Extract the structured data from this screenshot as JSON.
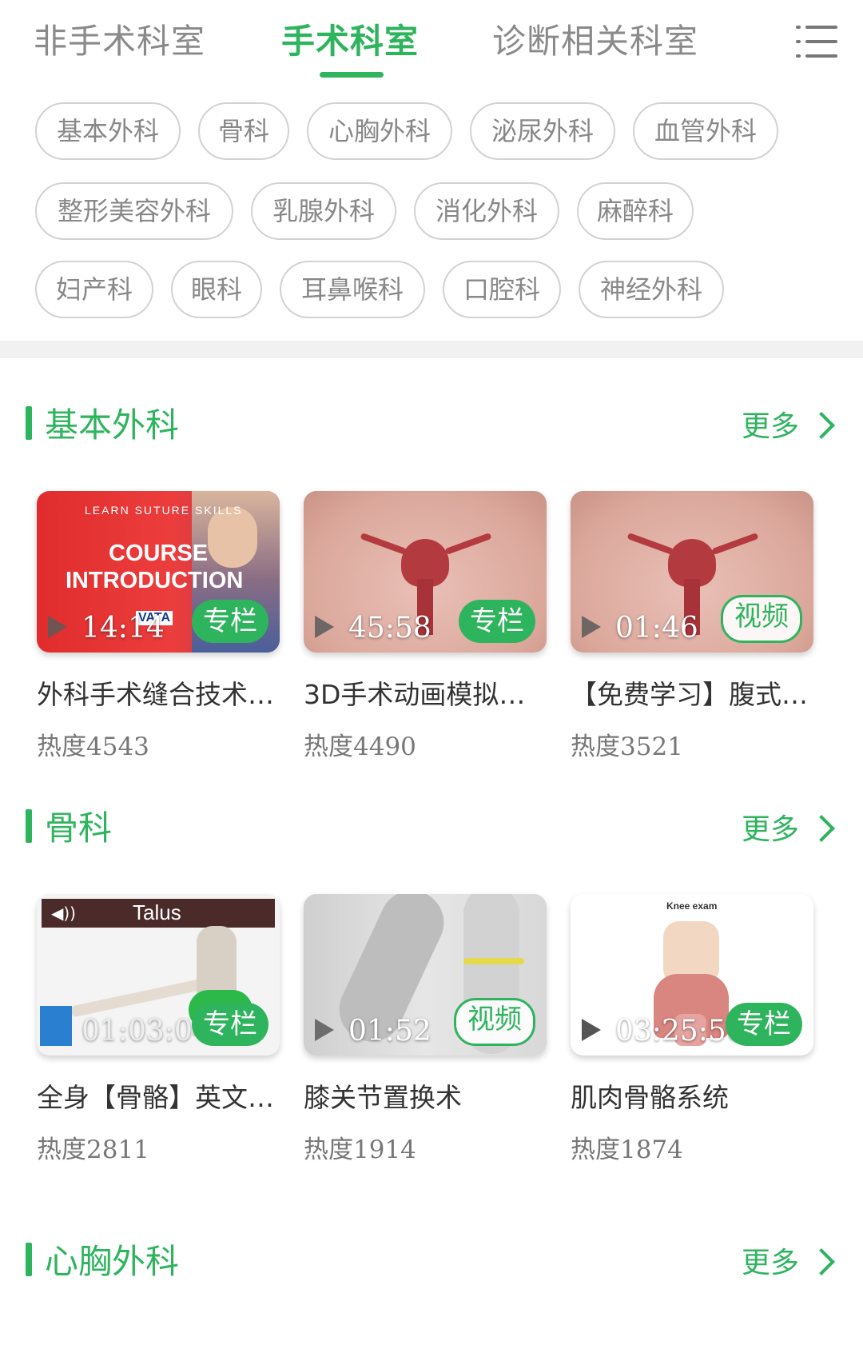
{
  "tabs": [
    {
      "label": "非手术科室",
      "active": false
    },
    {
      "label": "手术科室",
      "active": true
    },
    {
      "label": "诊断相关科室",
      "active": false
    }
  ],
  "menu_icon": "list-menu-icon",
  "chips": [
    [
      "基本外科",
      "骨科",
      "心胸外科",
      "泌尿外科",
      "血管外科"
    ],
    [
      "整形美容外科",
      "乳腺外科",
      "消化外科",
      "麻醉科"
    ],
    [
      "妇产科",
      "眼科",
      "耳鼻喉科",
      "口腔科",
      "神经外科"
    ]
  ],
  "colors": {
    "accent": "#2fb45e",
    "chip_border": "#d2d2d2",
    "muted": "#8a8a8a"
  },
  "sections": [
    {
      "title": "基本外科",
      "more": "更多",
      "cards": [
        {
          "title": "外科手术缝合技术…",
          "duration": "14:14",
          "badge": "专栏",
          "badge_style": "filled",
          "heat_label": "热度",
          "heat": "4543",
          "thumb_text": {
            "top": "LEARN SUTURE SKILLS",
            "line1": "COURSE",
            "line2": "INTRODUCTION",
            "logo": "VATA"
          }
        },
        {
          "title": "3D手术动画模拟…",
          "duration": "45:58",
          "badge": "专栏",
          "badge_style": "filled",
          "heat_label": "热度",
          "heat": "4490"
        },
        {
          "title": "【免费学习】腹式…",
          "duration": "01:46",
          "badge": "视频",
          "badge_style": "outline",
          "heat_label": "热度",
          "heat": "3521"
        }
      ]
    },
    {
      "title": "骨科",
      "more": "更多",
      "cards": [
        {
          "title": "全身【骨骼】英文…",
          "duration": "01:03:04",
          "badge": "专栏",
          "badge_style": "filled",
          "heat_label": "热度",
          "heat": "2811",
          "thumb_text": {
            "banner": "Talus"
          }
        },
        {
          "title": "膝关节置换术",
          "duration": "01:52",
          "badge": "视频",
          "badge_style": "outline",
          "heat_label": "热度",
          "heat": "1914"
        },
        {
          "title": "肌肉骨骼系统",
          "duration": "03:25:50",
          "badge": "专栏",
          "badge_style": "filled",
          "heat_label": "热度",
          "heat": "1874",
          "thumb_text": {
            "caption": "Knee exam"
          }
        }
      ]
    },
    {
      "title": "心胸外科",
      "more": "更多",
      "cards": []
    }
  ]
}
